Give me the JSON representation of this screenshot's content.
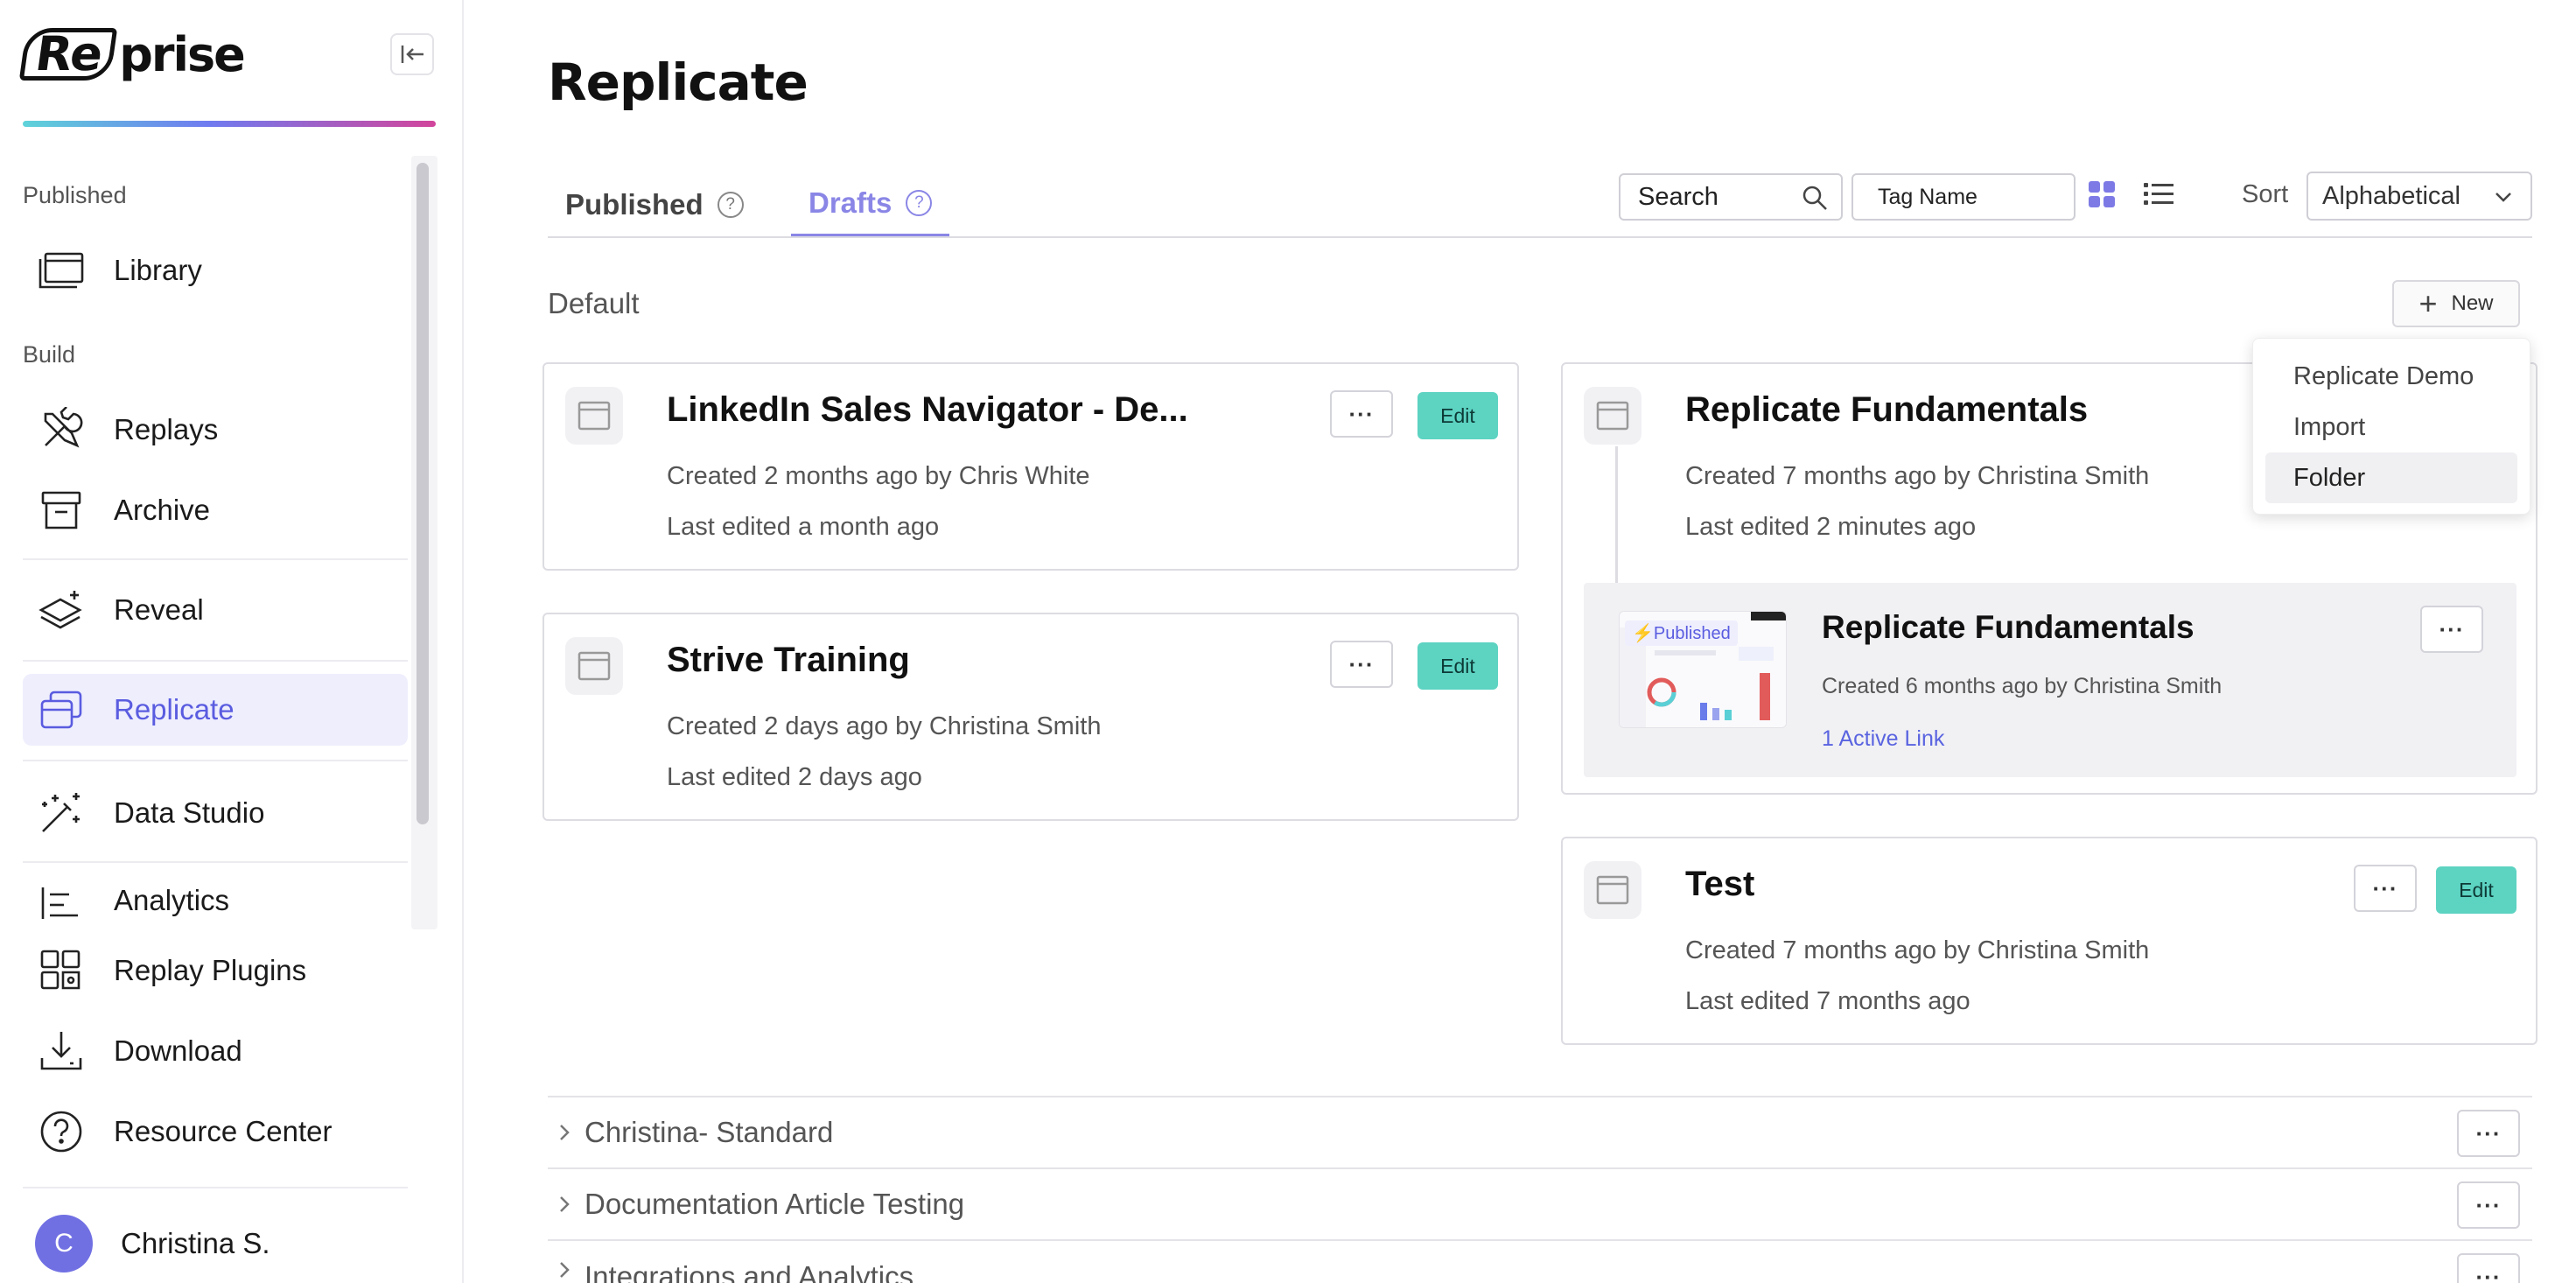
{
  "app": {
    "logo_re": "Re",
    "logo_rest": "prise",
    "collapse_icon": "collapse-sidebar-icon"
  },
  "sidebar": {
    "section_published": "Published",
    "section_build": "Build",
    "items": [
      {
        "label": "Library",
        "icon": "library-icon"
      },
      {
        "label": "Replays",
        "icon": "tools-icon"
      },
      {
        "label": "Archive",
        "icon": "archive-icon"
      },
      {
        "label": "Reveal",
        "icon": "layers-icon"
      },
      {
        "label": "Replicate",
        "icon": "replicate-icon",
        "active": true
      },
      {
        "label": "Data Studio",
        "icon": "magic-wand-icon"
      },
      {
        "label": "Analytics",
        "icon": "analytics-icon"
      },
      {
        "label": "Replay Plugins",
        "icon": "puzzle-icon"
      },
      {
        "label": "Download",
        "icon": "download-icon"
      },
      {
        "label": "Resource Center",
        "icon": "help-circle-icon"
      }
    ],
    "user": {
      "initial": "C",
      "name": "Christina S."
    }
  },
  "main": {
    "title": "Replicate",
    "tabs": [
      {
        "label": "Published",
        "active": false
      },
      {
        "label": "Drafts",
        "active": true
      }
    ],
    "toolbar": {
      "search_placeholder": "Search",
      "tag_placeholder": "Tag Name",
      "sort_label": "Sort",
      "sort_value": "Alphabetical"
    },
    "folder_default": "Default",
    "new_button": "New",
    "new_menu": [
      "Replicate Demo",
      "Import",
      "Folder"
    ],
    "cards": [
      {
        "title": "LinkedIn Sales Navigator - De...",
        "created": "Created 2 months ago by Chris White",
        "edited": "Last edited a month ago",
        "edit": "Edit"
      },
      {
        "title": "Strive Training",
        "created": "Created 2 days ago by Christina Smith",
        "edited": "Last edited 2 days ago",
        "edit": "Edit"
      },
      {
        "title": "Replicate Fundamentals",
        "created": "Created 7 months ago by Christina Smith",
        "edited": "Last edited 2 minutes ago"
      },
      {
        "title": "Test",
        "created": "Created 7 months ago by Christina Smith",
        "edited": "Last edited 7 months ago",
        "edit": "Edit"
      }
    ],
    "published_version": {
      "badge": "Published",
      "title": "Replicate Fundamentals",
      "created": "Created 6 months ago by Christina Smith",
      "link": "1 Active Link"
    },
    "folders": [
      "Christina- Standard",
      "Documentation Article Testing",
      "Integrations and Analytics"
    ],
    "colors": {
      "accent": "#5a5ce0",
      "edit_button": "#5dd3c2"
    }
  }
}
